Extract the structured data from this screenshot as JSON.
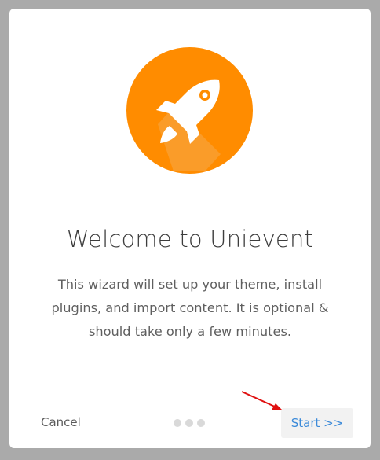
{
  "wizard": {
    "title": "Welcome to Unievent",
    "description": "This wizard will set up your theme, install plugins, and import content. It is optional & should take only a few minutes.",
    "cancel_label": "Cancel",
    "start_label": "Start >>",
    "steps_total": 3,
    "logo_icon": "rocket-icon"
  },
  "colors": {
    "logo_orange": "#ff8c00",
    "logo_shadow": "#f0a040",
    "start_text": "#3b8ad9",
    "annotation_arrow": "#e01010"
  }
}
